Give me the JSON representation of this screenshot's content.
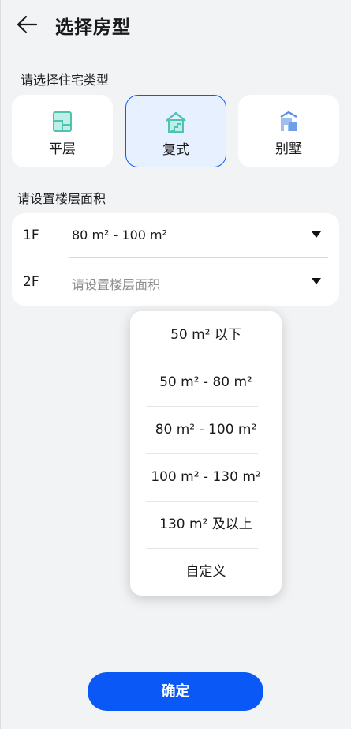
{
  "header": {
    "title": "选择房型",
    "back_icon": "arrow-left-icon"
  },
  "house_type": {
    "label": "请选择住宅类型",
    "options": [
      {
        "label": "平层",
        "icon": "flat-floor-icon",
        "selected": false
      },
      {
        "label": "复式",
        "icon": "duplex-house-icon",
        "selected": true
      },
      {
        "label": "别墅",
        "icon": "villa-icon",
        "selected": false
      }
    ]
  },
  "floor_area": {
    "label": "请设置楼层面积",
    "floors": [
      {
        "floor": "1F",
        "value": "80 m² - 100 m²",
        "placeholder": ""
      },
      {
        "floor": "2F",
        "value": "",
        "placeholder": "请设置楼层面积"
      }
    ]
  },
  "dropdown": {
    "options": [
      "50 m² 以下",
      "50 m² - 80 m²",
      "80 m² - 100 m²",
      "100 m² - 130 m²",
      "130 m² 及以上",
      "自定义"
    ]
  },
  "confirm_label": "确定",
  "colors": {
    "accent": "#0a59f7",
    "selected_bg": "#e7f0ff",
    "icon_teal": "#4fc3b0",
    "icon_blue": "#7aa4e8"
  }
}
